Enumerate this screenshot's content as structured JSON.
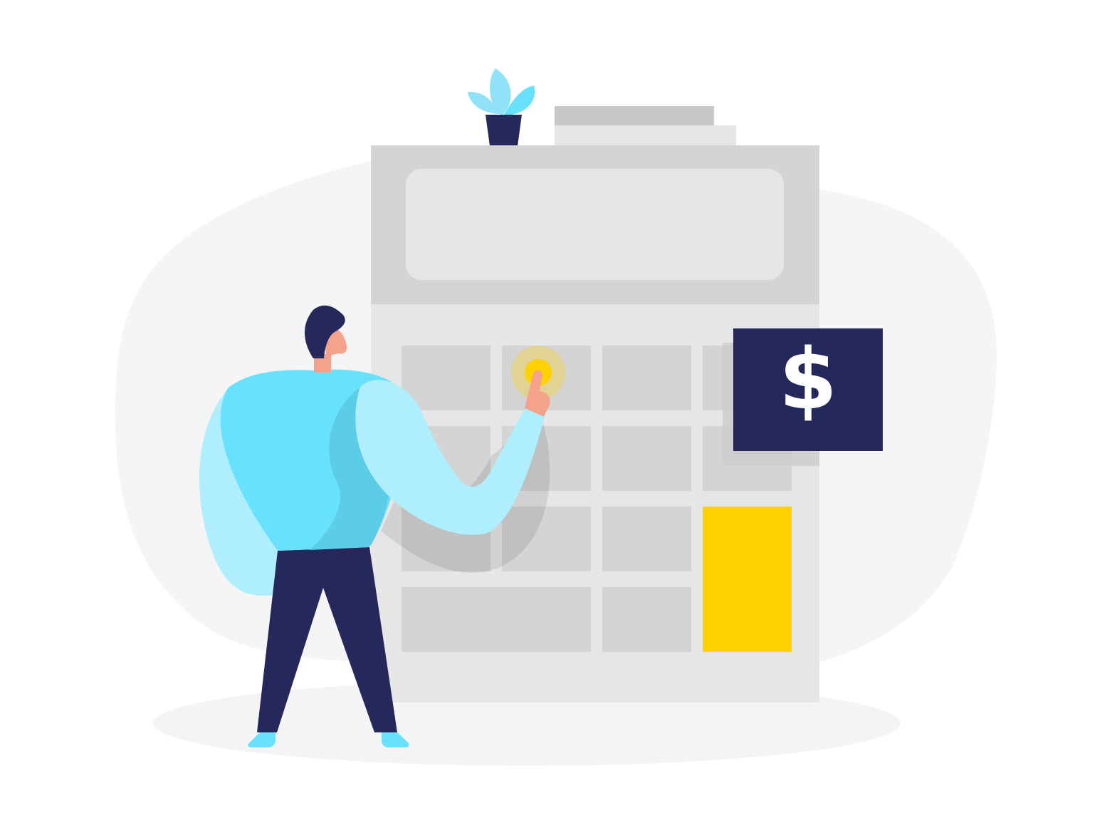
{
  "illustration": {
    "subject": "person-pressing-calculator-key",
    "price_tag_symbol": "$",
    "icons": {
      "plant": "potted-plant-icon",
      "papers": "paper-stack-icon",
      "calculator": "calculator-icon",
      "price_tag": "dollar-sign-icon"
    },
    "colors": {
      "backdrop_blob": "#f5f5f5",
      "floor_shadow": "#f4f4f4",
      "calculator_top": "#d4d4d4",
      "calculator_body": "#e6e6e6",
      "display": "#e6e6e6",
      "key": "#d4d4d4",
      "equals_key": "#ffd200",
      "pressed_key_glow": "#ffd200",
      "price_tag_bg": "#24285b",
      "price_tag_shadow": "#cccccc",
      "dollar_sign": "#ffffff",
      "paper_back": "#c8c8c8",
      "paper_front": "#e6e6e6",
      "pot": "#24285b",
      "leaf_light": "#a6eaff",
      "leaf_mid": "#8fe2f8",
      "leaf_dark": "#68e1fd",
      "hair": "#24285b",
      "skin": "#f4a28c",
      "shirt": "#68e1fd",
      "sleeve": "#aeeefd",
      "shirt_shade": "#5bcde6",
      "pants": "#24285b",
      "shoes": "#68e1fd",
      "arm_shadow": "#000000"
    }
  }
}
